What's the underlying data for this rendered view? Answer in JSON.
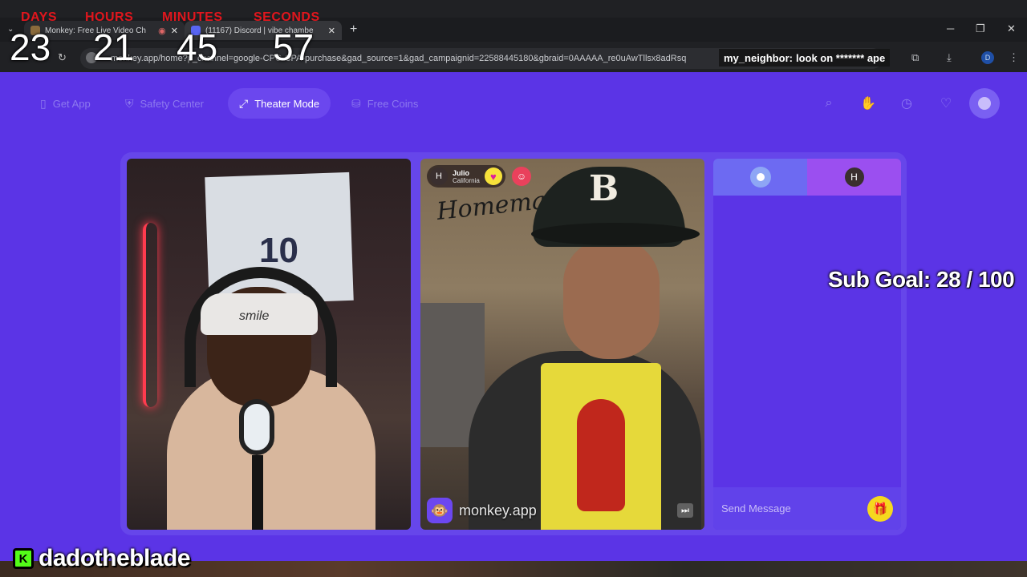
{
  "browser": {
    "tabs": [
      {
        "title": "Monkey: Free Live Video Ch",
        "active": false
      },
      {
        "title": "(11167) Discord | vibe chambe",
        "active": true
      }
    ],
    "address": "monkey.app/home?p_channel=google-CPC-CPA-purchase&gad_source=1&gad_campaignid=22588445180&gbraid=0AAAAA_re0uAwTllsx8adRsq",
    "profile_initial": "D"
  },
  "countdown": {
    "labels": {
      "days": "DAYS",
      "hours": "HOURS",
      "minutes": "MINUTES",
      "seconds": "SECONDS"
    },
    "values": {
      "days": "23",
      "hours": "21",
      "minutes": "45",
      "seconds": "57"
    }
  },
  "chat_alert": {
    "user": "my_neighbor:",
    "message": "look on ******* ape"
  },
  "nav": {
    "get_app": "Get App",
    "safety_center": "Safety Center",
    "theater_mode": "Theater Mode",
    "free_coins": "Free Coins"
  },
  "self_video": {
    "headband_text": "smile",
    "jersey_number": "10"
  },
  "peer": {
    "initial": "H",
    "name": "Julio",
    "location": "California",
    "sign_text": "Homemade",
    "cap_logo": "B"
  },
  "watermark": {
    "text": "monkey.app"
  },
  "chat_panel": {
    "peer_initial": "H",
    "input_placeholder": "Send Message"
  },
  "overlay": {
    "sub_goal": "Sub Goal:  28 / 100",
    "streamer_name": "dadotheblade",
    "platform_badge": "K"
  },
  "colors": {
    "app_bg": "#5b34e6",
    "countdown_label": "#e0161d",
    "kick_green": "#53fc18",
    "gift_yellow": "#f5d81e"
  },
  "icons": [
    "phone-icon",
    "shield-icon",
    "expand-icon",
    "coins-icon",
    "search-icon",
    "hand-icon",
    "history-icon",
    "chat-heart-icon",
    "gift-icon"
  ]
}
